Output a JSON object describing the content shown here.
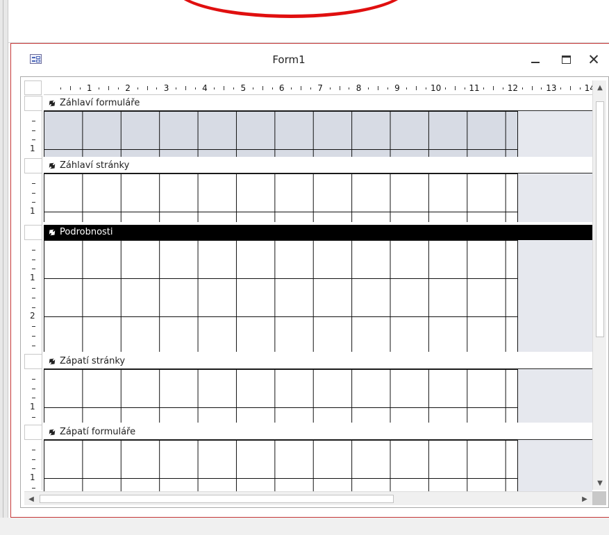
{
  "window": {
    "title": "Form1",
    "minimize_icon": "minimize-icon",
    "maximize_icon": "maximize-icon",
    "close_label": "✕"
  },
  "ruler": {
    "numbers": [
      "1",
      "2",
      "3",
      "4",
      "5",
      "6",
      "7",
      "8",
      "9",
      "10",
      "11",
      "12",
      "13",
      "14"
    ],
    "left_numbers": [
      "1",
      "1",
      "1",
      "2",
      "1",
      "1"
    ]
  },
  "sections": [
    {
      "label": "Záhlaví formuláře",
      "shaded": true,
      "selected": false
    },
    {
      "label": "Záhlaví stránky",
      "shaded": false,
      "selected": false
    },
    {
      "label": "Podrobnosti",
      "shaded": false,
      "selected": true
    },
    {
      "label": "Zápatí stránky",
      "shaded": false,
      "selected": false
    },
    {
      "label": "Zápatí formuláře",
      "shaded": false,
      "selected": false
    }
  ],
  "colors": {
    "annotation_ellipse": "#e00f0f",
    "window_border": "#c43535",
    "header_shade": "#d7dbe4",
    "off_form_area": "#e6e8ee"
  }
}
